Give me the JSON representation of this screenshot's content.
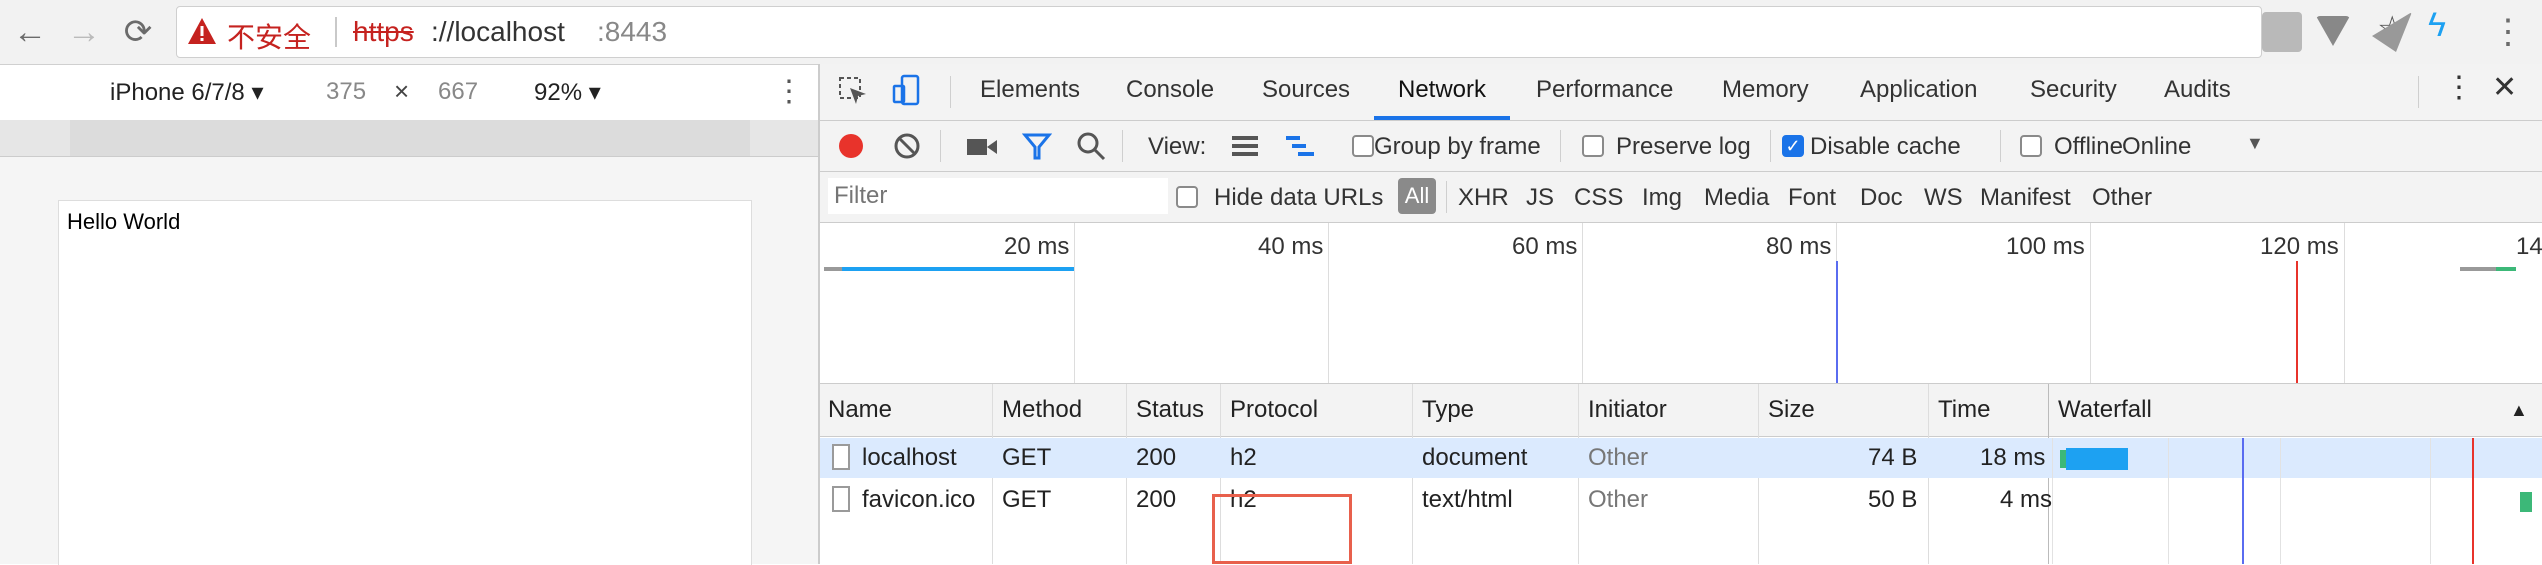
{
  "browser": {
    "security_label": "不安全",
    "url_scheme": "https",
    "url_sep_host": "://localhost",
    "url_port": ":8443",
    "icons": [
      "back-icon",
      "forward-icon",
      "reload-icon",
      "warning-icon",
      "star-icon",
      "extension-icons"
    ]
  },
  "device_toolbar": {
    "device": "iPhone 6/7/8 ▾",
    "width": "375",
    "times": "×",
    "height": "667",
    "zoom": "92% ▾",
    "more": "⋮"
  },
  "page": {
    "content": "Hello World"
  },
  "devtools": {
    "tabs": [
      "Elements",
      "Console",
      "Sources",
      "Network",
      "Performance",
      "Memory",
      "Application",
      "Security",
      "Audits"
    ],
    "active_tab": "Network",
    "toolbar": {
      "view_label": "View:",
      "group_by_frame": "Group by frame",
      "preserve_log": "Preserve log",
      "disable_cache": "Disable cache",
      "offline": "Offline",
      "throttle": "Online",
      "disable_cache_checked": true
    },
    "filter_bar": {
      "placeholder": "Filter",
      "hide_data_urls": "Hide data URLs",
      "all": "All",
      "types": [
        "XHR",
        "JS",
        "CSS",
        "Img",
        "Media",
        "Font",
        "Doc",
        "WS",
        "Manifest",
        "Other"
      ]
    },
    "overview_ticks": [
      "20 ms",
      "40 ms",
      "60 ms",
      "80 ms",
      "100 ms",
      "120 ms",
      "14"
    ],
    "columns": [
      "Name",
      "Method",
      "Status",
      "Protocol",
      "Type",
      "Initiator",
      "Size",
      "Time",
      "Waterfall"
    ],
    "rows": [
      {
        "name": "localhost",
        "method": "GET",
        "status": "200",
        "protocol": "h2",
        "type": "document",
        "initiator": "Other",
        "size": "74 B",
        "time": "18 ms"
      },
      {
        "name": "favicon.ico",
        "method": "GET",
        "status": "200",
        "protocol": "h2",
        "type": "text/html",
        "initiator": "Other",
        "size": "50 B",
        "time": "4 ms"
      }
    ],
    "colors": {
      "accent": "#1a73e8",
      "record": "#e8332b",
      "highlight_box": "#e8604c",
      "waterfall_bar": "#1da1f2"
    }
  }
}
